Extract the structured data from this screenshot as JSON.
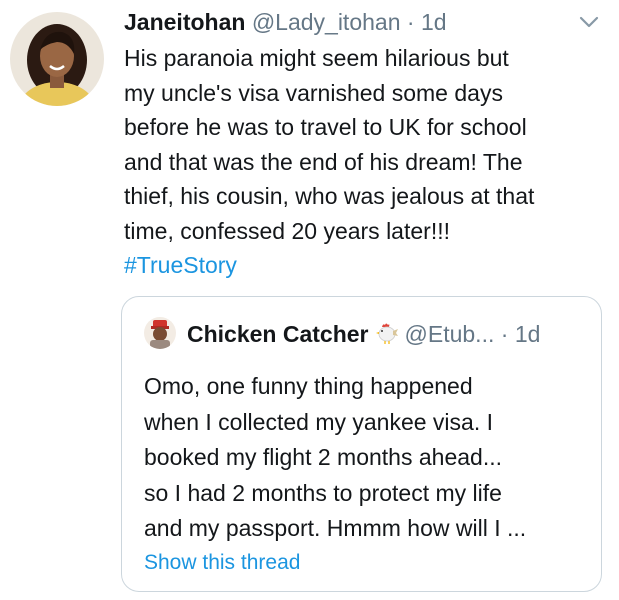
{
  "tweet": {
    "author_name": "Janeitohan",
    "author_handle": "@Lady_itohan",
    "separator": "·",
    "time": "1d",
    "text_lines": [
      "His paranoia might seem hilarious but",
      "my uncle's visa varnished some days",
      "before he was to travel to UK for school",
      "and that was the end of his dream! The",
      "thief, his cousin, who was jealous at that",
      "time, confessed 20 years later!!!"
    ],
    "hashtag": "#TrueStory",
    "icons": {
      "avatar": "profile-photo",
      "menu": "chevron-down-icon"
    }
  },
  "quoted": {
    "author_name": "Chicken Catcher",
    "author_handle": "@Etub...",
    "separator": "·",
    "time": "1d",
    "text_lines": [
      "Omo, one funny thing happened",
      "when I collected my yankee visa. I",
      "booked my flight 2 months ahead...",
      "so I had 2 months to protect my life",
      "and my passport. Hmmm how will I ..."
    ],
    "show_thread": "Show this thread",
    "icons": {
      "avatar": "profile-photo",
      "name_emoji": "rooster-emoji-icon"
    }
  },
  "colors": {
    "link": "#1b95e0",
    "secondary_text": "#657786",
    "border": "#ccd6dd"
  }
}
